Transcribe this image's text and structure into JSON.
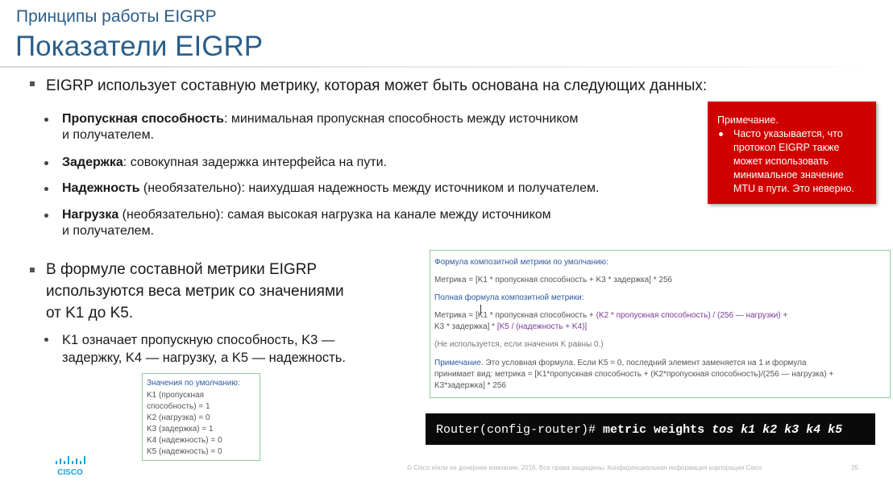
{
  "header": {
    "sup_title": "Принципы работы EIGRP",
    "title": "Показатели EIGRP"
  },
  "bullet1": {
    "text": "EIGRP использует составную метрику, которая может быть основана на следующих данных:",
    "items": [
      {
        "term": "Пропускная способность",
        "rest_line1": ": минимальная пропускная способность между источником",
        "rest_line2": "и получателем."
      },
      {
        "term": "Задержка",
        "rest_line1": ": совокупная задержка интерфейса на пути.",
        "rest_line2": ""
      },
      {
        "term": "Надежность",
        "rest_line1": " (необязательно): наихудшая надежность между источником и получателем.",
        "rest_line2": ""
      },
      {
        "term": "Нагрузка",
        "rest_line1": " (необязательно): самая высокая нагрузка на канале между источником",
        "rest_line2": "и получателем."
      }
    ]
  },
  "bullet2": {
    "text_line1": "В формуле составной метрики EIGRP",
    "text_line2": "используются веса метрик со значениями",
    "text_line3": "от K1 до K5.",
    "sub_line1": "K1 означает пропускную способность, K3 —",
    "sub_line2": "задержку, K4 — нагрузку, а K5 — надежность."
  },
  "note": {
    "title": "Примечание.",
    "text_line1": "Часто указывается, что",
    "text_line2": "протокол EIGRP также",
    "text_line3": "может использовать",
    "text_line4": "минимальное значение",
    "text_line5": "MTU в пути. Это неверно."
  },
  "formula": {
    "default_title": "Формула композитной метрики по умолчанию:",
    "default_formula": "Метрика = [K1 * пропускная способность + K3 * задержка] * 256",
    "full_title": "Полная формула композитной метрики:",
    "full_a": "Метрика = [K1 * пропускная способность + ",
    "full_b": "(K2 * пропускная способность) / (256 — нагрузки)",
    "full_c": " +",
    "full_d": "K3 * задержка] * ",
    "full_e": "[K5 / (надежность + K4)]",
    "unused": "(Не используется, если значения K равны 0.)",
    "note_label": "Примечание",
    "note_line1": ". Это условная формула. Если K5 = 0, последний элемент заменяется на 1 и формула",
    "note_line2": "принимает вид: метрика = [K1*пропускная способность + (K2*пропускная способность)/(256 — нагрузка) +",
    "note_line3": "K3*задержка] * 256"
  },
  "defaults": {
    "title": "Значения по умолчанию:",
    "lines": [
      "K1 (пропускная",
      "способность) = 1",
      "K2 (нагрузка) = 0",
      "K3 (задержка) = 1",
      "K4 (надежность) = 0",
      "K5 (надежность) = 0"
    ]
  },
  "command": {
    "prompt": "Router(config-router)# ",
    "keyword": "metric weights ",
    "args": "tos k1 k2 k3 k4 k5"
  },
  "footer": {
    "copyright": "© Cisco и/или ее дочерние компании, 2016. Все права защищены. Конфиденциальная информация корпорации Cisco",
    "page": "35",
    "logo_text": "CISCO"
  },
  "colors": {
    "title_blue": "#2a5e8a",
    "note_red": "#d00000",
    "formula_blue": "#2c59a0",
    "formula_purple": "#7a3a97"
  }
}
